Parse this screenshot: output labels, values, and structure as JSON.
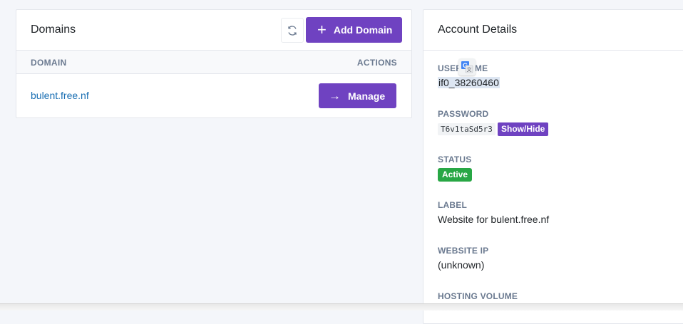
{
  "domains_card": {
    "title": "Domains",
    "add_button_label": "Add Domain",
    "table": {
      "headers": [
        "DOMAIN",
        "ACTIONS"
      ],
      "rows": [
        {
          "domain": "bulent.free.nf",
          "action_label": "Manage"
        }
      ]
    }
  },
  "account_card": {
    "title": "Account Details",
    "username_label": "USERNAME",
    "username_value": "if0_38260460",
    "password_label": "PASSWORD",
    "password_value": "T6v1taSd5r3",
    "show_hide_label": "Show/Hide",
    "status_label": "STATUS",
    "status_value": "Active",
    "label_label": "LABEL",
    "label_value": "Website for bulent.free.nf",
    "ip_label": "WEBSITE IP",
    "ip_value": "(unknown)",
    "volume_label": "HOSTING VOLUME"
  },
  "colors": {
    "accent": "#6f42c1",
    "success": "#28a745",
    "link": "#1a6fb3"
  },
  "icons": [
    "refresh-icon",
    "plus-icon",
    "arrow-right-icon",
    "google-translate-icon"
  ]
}
